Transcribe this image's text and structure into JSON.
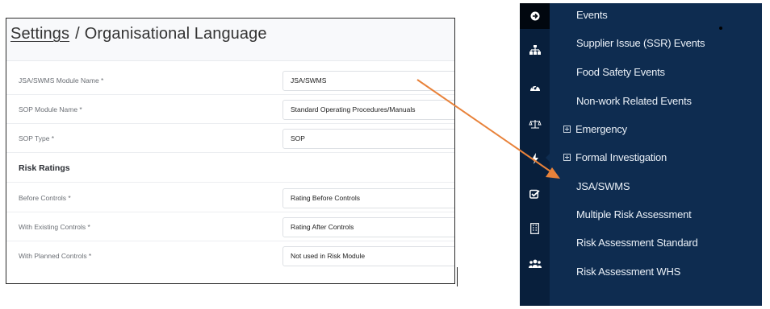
{
  "settings": {
    "breadcrumb_link": "Settings",
    "breadcrumb_sep": "/",
    "page_title": "Organisational Language",
    "fields": [
      {
        "label": "JSA/SWMS Module Name *",
        "value": "JSA/SWMS"
      },
      {
        "label": "SOP Module Name *",
        "value": "Standard Operating Procedures/Manuals"
      },
      {
        "label": "SOP Type *",
        "value": "SOP"
      }
    ],
    "risk_section_title": "Risk Ratings",
    "risk_fields": [
      {
        "label": "Before Controls *",
        "value": "Rating Before Controls"
      },
      {
        "label": "With Existing Controls *",
        "value": "Rating After Controls"
      },
      {
        "label": "With Planned Controls *",
        "value": "Not used in Risk Module"
      }
    ]
  },
  "sidebar": {
    "icons": [
      "arrow-circle-right-icon",
      "sitemap-icon",
      "dashboard-icon",
      "balance-scale-icon",
      "bolt-icon",
      "check-square-icon",
      "building-icon",
      "users-icon"
    ],
    "items": [
      {
        "label": "Events"
      },
      {
        "label": "Supplier Issue (SSR) Events"
      },
      {
        "label": "Food Safety Events"
      },
      {
        "label": "Non-work Related Events"
      },
      {
        "label": "Emergency",
        "expandable": true
      },
      {
        "label": "Formal Investigation",
        "expandable": true
      },
      {
        "label": "JSA/SWMS"
      },
      {
        "label": "Multiple Risk Assessment"
      },
      {
        "label": "Risk Assessment Standard"
      },
      {
        "label": "Risk Assessment WHS"
      }
    ]
  },
  "colors": {
    "sidebar_bg": "#0e2c50",
    "icon_column_bg": "#081f3c",
    "annotation_arrow": "#e8823a"
  }
}
